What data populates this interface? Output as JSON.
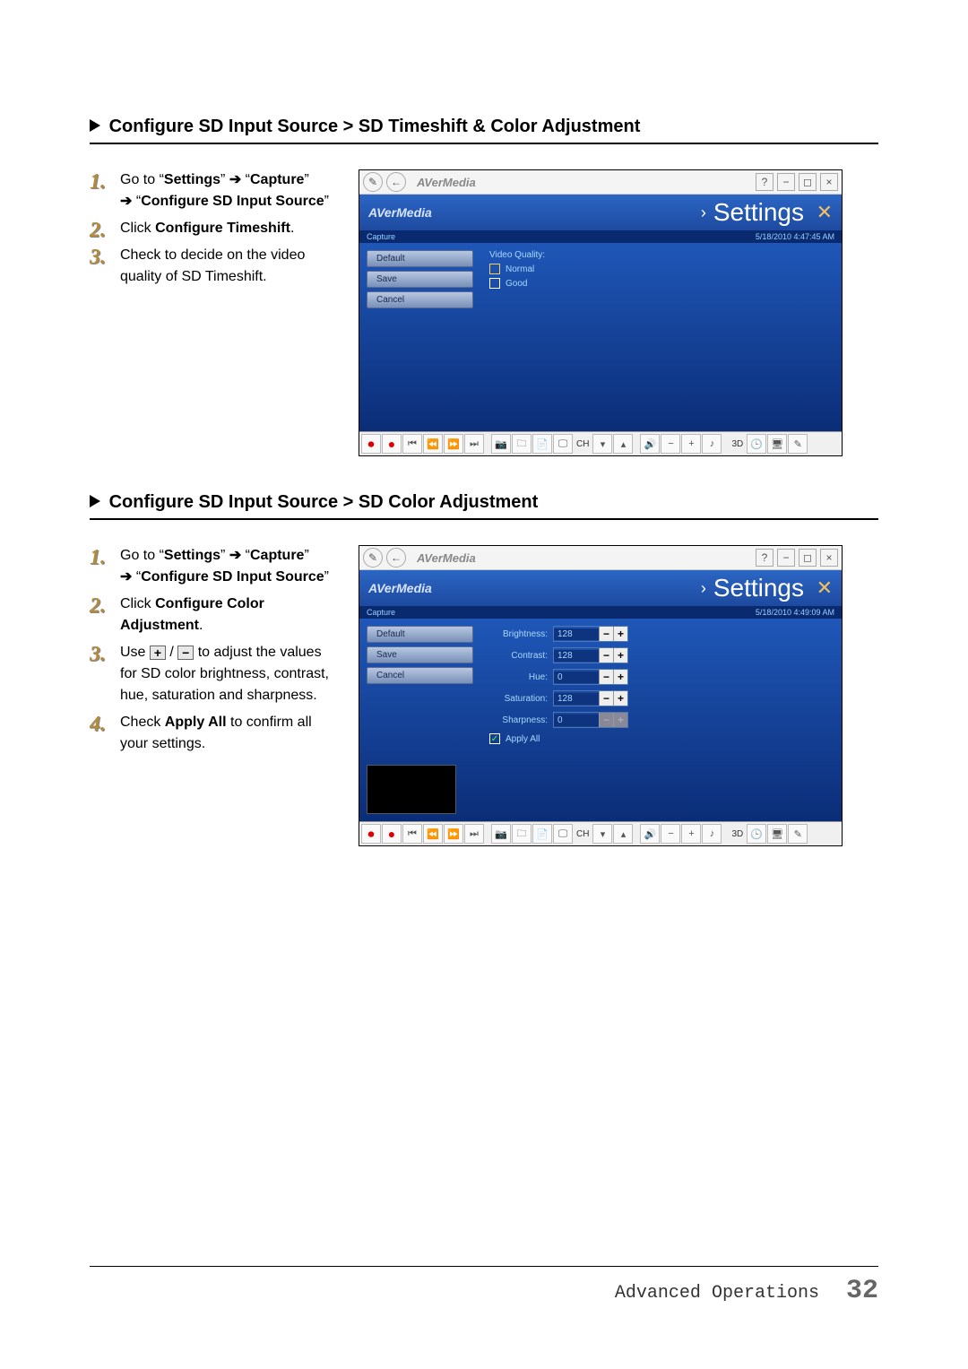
{
  "section1": {
    "heading": "Configure SD Input Source > SD Timeshift & Color Adjustment",
    "steps": {
      "s1a": "Go to “",
      "s1b": "Settings",
      "s1c": "” ",
      "s1d": " “",
      "s1e": "Capture",
      "s1f": "” ",
      "s1g": " “",
      "s1h": "Configure SD Input Source",
      "s1i": "”",
      "s2a": "Click ",
      "s2b": "Configure Timeshift",
      "s2c": ".",
      "s3": "Check to decide on the video quality of SD Timeshift."
    },
    "mock": {
      "brand": "AVerMedia",
      "headerTitle": "Settings",
      "crumb": "Capture",
      "timestamp": "5/18/2010 4:47:45 AM",
      "sidebar": [
        "Default",
        "Save",
        "Cancel"
      ],
      "vq_label": "Video Quality:",
      "normal": "Normal",
      "good": "Good"
    }
  },
  "section2": {
    "heading": "Configure SD Input Source > SD Color Adjustment",
    "steps": {
      "s1a": "Go to “",
      "s1b": "Settings",
      "s1c": "” ",
      "s1d": " “",
      "s1e": "Capture",
      "s1f": "” ",
      "s1g": " “",
      "s1h": "Configure SD Input Source",
      "s1i": "”",
      "s2a": "Click ",
      "s2b": "Configure Color Adjustment",
      "s2c": ".",
      "s3a": "Use ",
      "s3b": " / ",
      "s3c": " to adjust the values for SD color brightness, contrast, hue, saturation and sharpness.",
      "s4a": "Check ",
      "s4b": "Apply All",
      "s4c": " to confirm all your settings."
    },
    "mock": {
      "brand": "AVerMedia",
      "headerTitle": "Settings",
      "crumb": "Capture",
      "timestamp": "5/18/2010 4:49:09 AM",
      "sidebar": [
        "Default",
        "Save",
        "Cancel"
      ],
      "rows": [
        {
          "label": "Brightness:",
          "val": "128"
        },
        {
          "label": "Contrast:",
          "val": "128"
        },
        {
          "label": "Hue:",
          "val": "0"
        },
        {
          "label": "Saturation:",
          "val": "128"
        },
        {
          "label": "Sharpness:",
          "val": "0"
        }
      ],
      "apply": "Apply All"
    }
  },
  "toolbar": {
    "ch": "CH",
    "threeD": "3D"
  },
  "footer": {
    "label": "Advanced Operations",
    "page": "32"
  }
}
